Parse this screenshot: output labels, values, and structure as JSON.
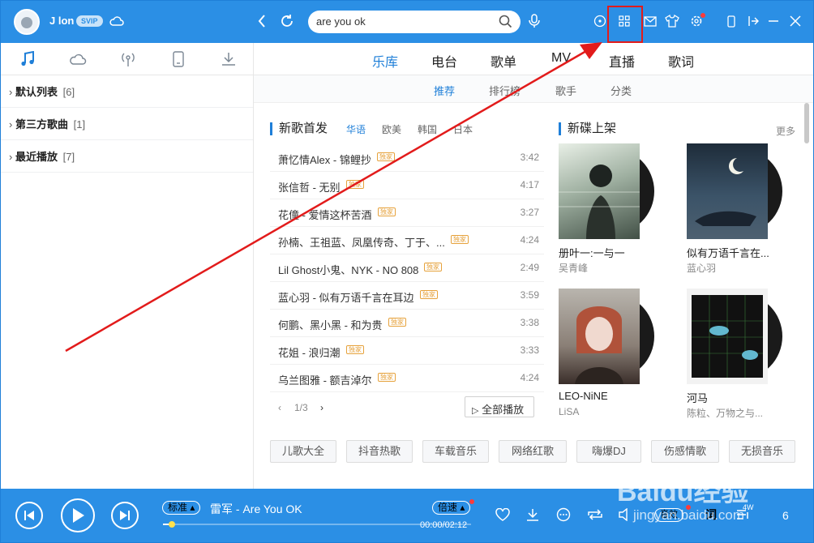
{
  "user": {
    "name": "J lon",
    "vip": "SVIP"
  },
  "search": {
    "value": "are you ok"
  },
  "nav_tabs": [
    "乐库",
    "电台",
    "歌单",
    "MV",
    "直播",
    "歌词"
  ],
  "sub_tabs": [
    "推荐",
    "排行榜",
    "歌手",
    "分类"
  ],
  "left_list": [
    {
      "label": "默认列表",
      "count": "[6]"
    },
    {
      "label": "第三方歌曲",
      "count": "[1]"
    },
    {
      "label": "最近播放",
      "count": "[7]"
    }
  ],
  "new_songs": {
    "title": "新歌首发",
    "langs": [
      "华语",
      "欧美",
      "韩国",
      "日本"
    ],
    "badge": "独家",
    "songs": [
      {
        "name": "萧忆情Alex - 锦鲤抄",
        "dur": "3:42"
      },
      {
        "name": "张信哲 - 无别",
        "dur": "4:17"
      },
      {
        "name": "花僮 - 爱情这杯苦酒",
        "dur": "3:27"
      },
      {
        "name": "孙楠、王祖蓝、凤凰传奇、丁于、...",
        "dur": "4:24"
      },
      {
        "name": "Lil Ghost小鬼、NYK - NO 808",
        "dur": "2:49"
      },
      {
        "name": "蓝心羽 - 似有万语千言在耳边",
        "dur": "3:59"
      },
      {
        "name": "何鹏、黑小黑 - 和为贵",
        "dur": "3:38"
      },
      {
        "name": "花姐 - 浪归潮",
        "dur": "3:33"
      },
      {
        "name": "乌兰图雅 - 额吉淖尔",
        "dur": "4:24"
      }
    ],
    "page": "1/3",
    "play_all": "全部播放"
  },
  "new_albums": {
    "title": "新碟上架",
    "more": "更多",
    "albums": [
      {
        "name": "册叶一:一与一",
        "artist": "吴青峰"
      },
      {
        "name": "似有万语千言在...",
        "artist": "蓝心羽"
      },
      {
        "name": "LEO-NiNE",
        "artist": "LiSA"
      },
      {
        "name": "河马",
        "artist": "陈粒、万物之与..."
      }
    ]
  },
  "tags": [
    "儿歌大全",
    "抖音热歌",
    "车载音乐",
    "网络红歌",
    "嗨爆DJ",
    "伤感情歌",
    "无损音乐"
  ],
  "player": {
    "quality": "标准",
    "track": "雷军 - Are You OK",
    "speed": "倍速",
    "time": "00:00/02:12",
    "lyric": "词",
    "count_badge": "4W",
    "count": "6",
    "progress": 0.03
  },
  "watermark": {
    "logo": "Baidu经验",
    "url": "jingyan.baidu.com"
  },
  "colors": {
    "primary": "#2b8fe5",
    "accent": "#1f7fd8",
    "highlight": "#e21b1b"
  }
}
